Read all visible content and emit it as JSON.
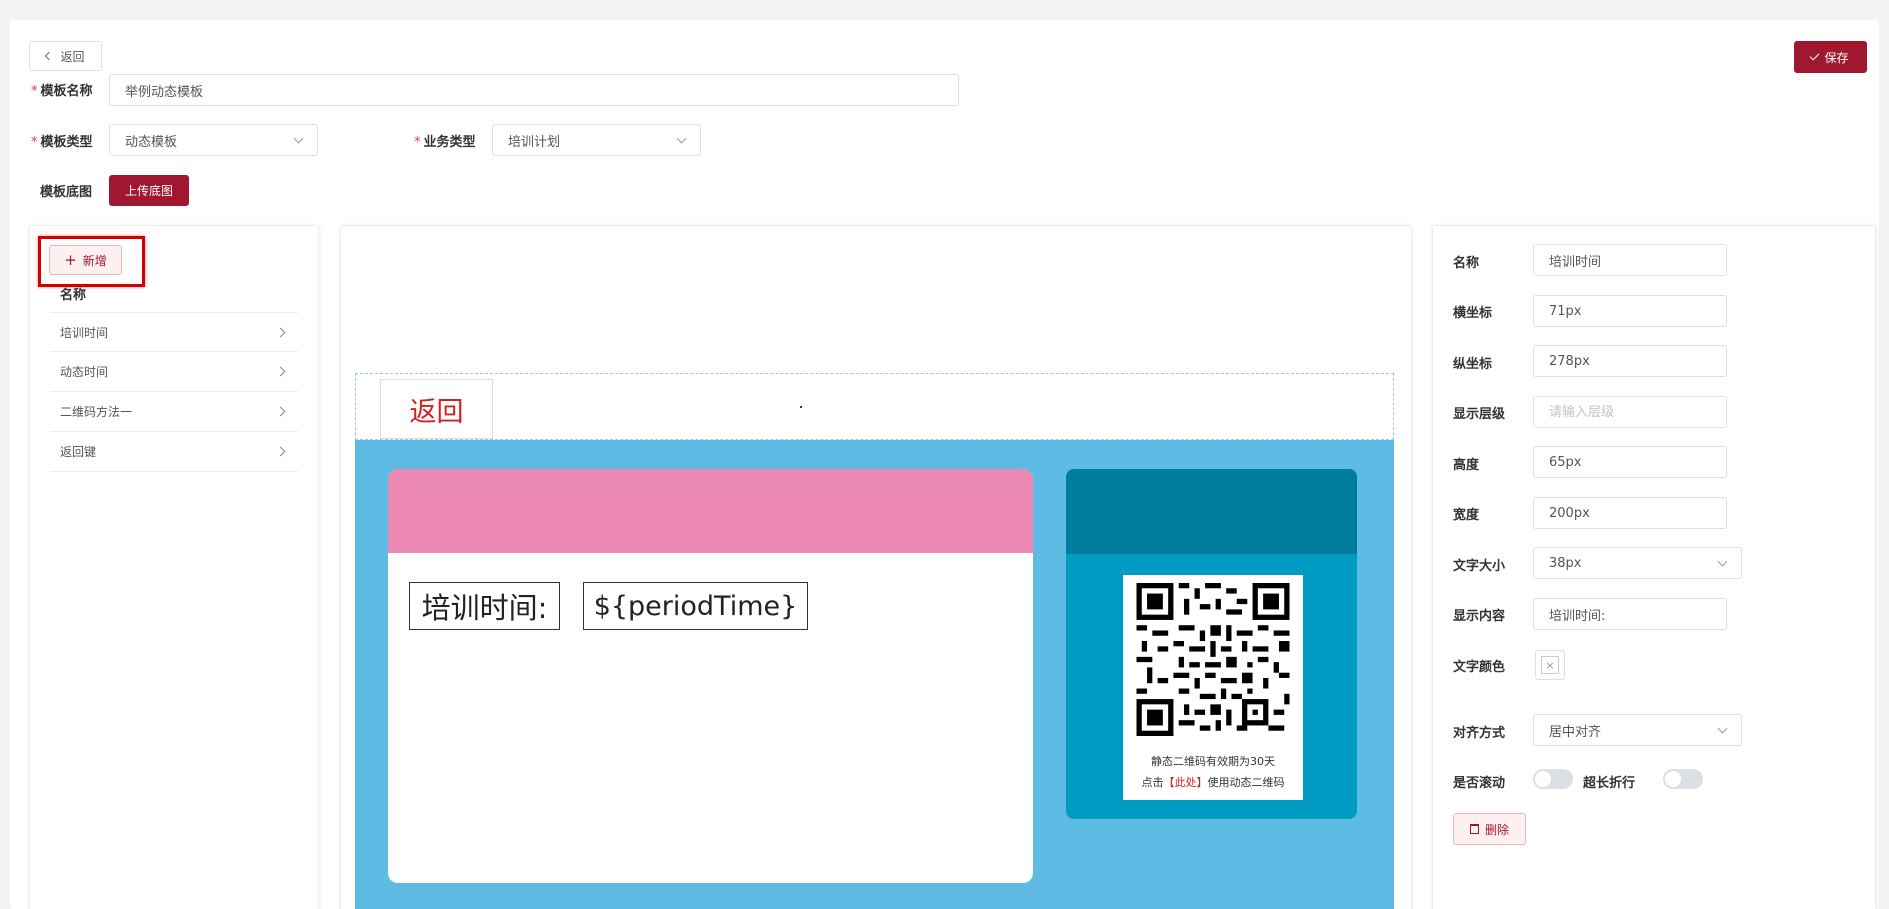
{
  "header": {
    "back_label": "返回",
    "save_label": "保存"
  },
  "form": {
    "template_name_label": "模板名称",
    "template_name_value": "举例动态模板",
    "template_type_label": "模板类型",
    "template_type_value": "动态模板",
    "business_type_label": "业务类型",
    "business_type_value": "培训计划",
    "base_image_label": "模板底图",
    "upload_label": "上传底图"
  },
  "left_panel": {
    "add_label": "新增",
    "column_header": "名称",
    "items": [
      {
        "label": "培训时间"
      },
      {
        "label": "动态时间"
      },
      {
        "label": "二维码方法一"
      },
      {
        "label": "返回键"
      }
    ]
  },
  "canvas": {
    "back_text": "返回",
    "field_label": "培训时间:",
    "field_value": "${periodTime}",
    "qr_line1": "静态二维码有效期为30天",
    "qr_line2_prefix": "点击",
    "qr_line2_link": "【此处】",
    "qr_line2_suffix": "使用动态二维码",
    "colors": {
      "background": "#5dbbe4",
      "card_header": "#ec88b4",
      "qr_panel_header": "#007c9c",
      "qr_panel_body": "#009bc3"
    }
  },
  "properties": {
    "name_label": "名称",
    "name_value": "培训时间",
    "x_label": "横坐标",
    "x_value": "71px",
    "y_label": "纵坐标",
    "y_value": "278px",
    "z_label": "显示层级",
    "z_placeholder": "请输入层级",
    "height_label": "高度",
    "height_value": "65px",
    "width_label": "宽度",
    "width_value": "200px",
    "font_size_label": "文字大小",
    "font_size_value": "38px",
    "content_label": "显示内容",
    "content_value": "培训时间:",
    "color_label": "文字颜色",
    "align_label": "对齐方式",
    "align_value": "居中对齐",
    "scroll_label": "是否滚动",
    "wrap_label": "超长折行",
    "delete_label": "删除"
  },
  "brand_color": "#a0182f"
}
